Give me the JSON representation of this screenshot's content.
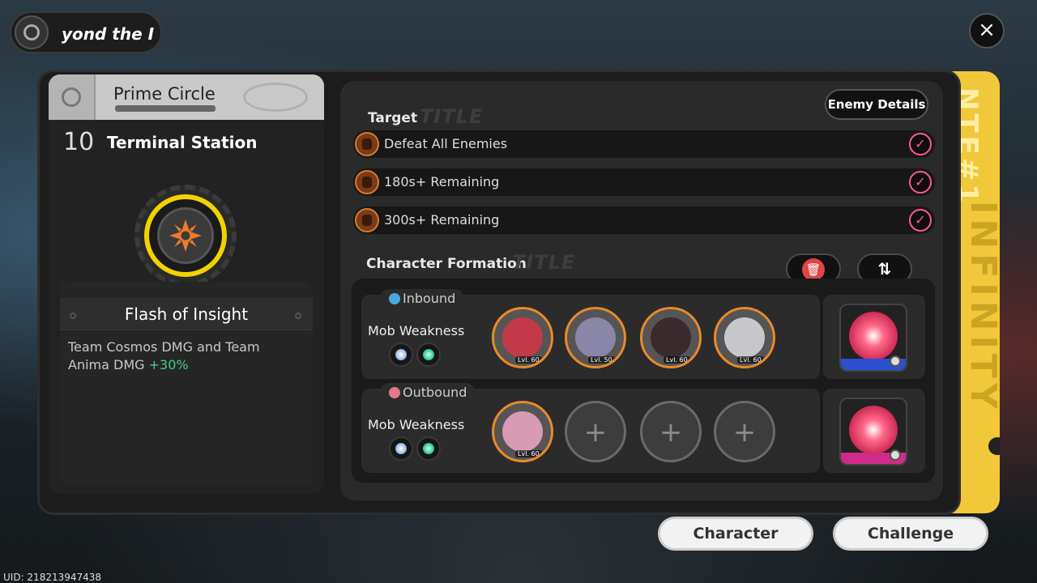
{
  "header": {
    "title": "yond the I",
    "close_icon": "×"
  },
  "stage": {
    "category": "Prime Circle",
    "number": "10",
    "name": "Terminal Station"
  },
  "buff": {
    "title": "Flash of Insight",
    "description": "Team Cosmos DMG and Team Anima DMG ",
    "bonus": "+30%"
  },
  "target": {
    "label": "Target",
    "deco": "TITLE",
    "enemy_details_label": "Enemy Details",
    "objectives": [
      {
        "text": "Defeat All Enemies",
        "done": true
      },
      {
        "text": "180s+ Remaining",
        "done": true
      },
      {
        "text": "300s+ Remaining",
        "done": true
      }
    ]
  },
  "formation": {
    "label": "Character Formation",
    "deco": "TITLE",
    "trash_icon": "🗑",
    "swap_icon": "⇅",
    "teams": [
      {
        "name": "Inbound",
        "mob_weakness_label": "Mob Weakness",
        "weaknesses": [
          "cosmos-icon",
          "anima-icon"
        ],
        "members": [
          {
            "level": "Lvl. 60",
            "color": "#c23a4a"
          },
          {
            "level": "Lvl. 50",
            "color": "#8a86a8"
          },
          {
            "level": "Lvl. 60",
            "color": "#3a2a2e"
          },
          {
            "level": "Lvl. 60",
            "color": "#c8c8cc"
          }
        ],
        "empty_slots": 0
      },
      {
        "name": "Outbound",
        "mob_weakness_label": "Mob Weakness",
        "weaknesses": [
          "cosmos-icon",
          "anima-icon"
        ],
        "members": [
          {
            "level": "Lvl. 60",
            "color": "#d99ab4"
          }
        ],
        "empty_slots": 3,
        "plus_icon": "+"
      }
    ]
  },
  "actions": {
    "character_label": "Character",
    "challenge_label": "Challenge"
  },
  "footer": {
    "uid": "UID: 218213947438"
  },
  "colors": {
    "accent_yellow": "#f0c83a",
    "check_pink": "#ff5a8e",
    "bonus_green": "#3ed08a",
    "char_border": "#e98a2a"
  }
}
